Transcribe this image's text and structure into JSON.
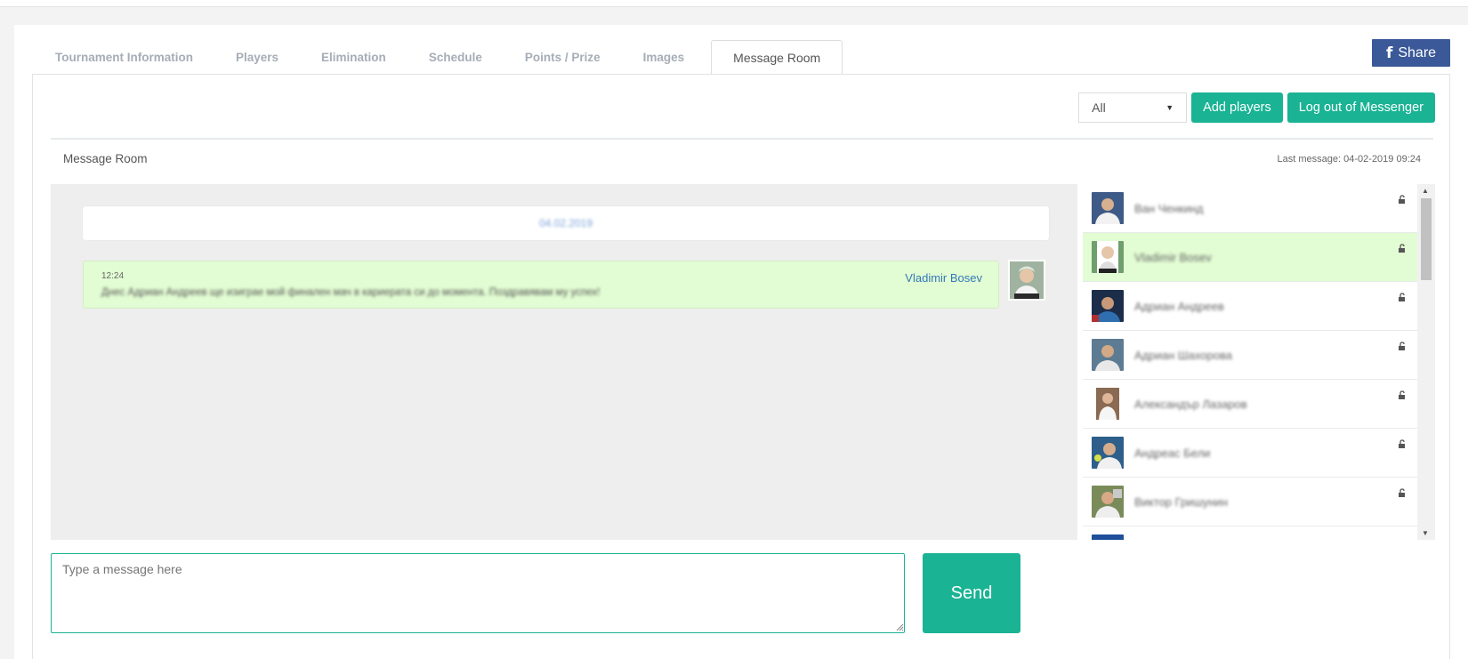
{
  "tabs": [
    {
      "label": "Tournament Information",
      "active": false
    },
    {
      "label": "Players",
      "active": false
    },
    {
      "label": "Elimination",
      "active": false
    },
    {
      "label": "Schedule",
      "active": false
    },
    {
      "label": "Points / Prize",
      "active": false
    },
    {
      "label": "Images",
      "active": false
    },
    {
      "label": "Message Room",
      "active": true
    }
  ],
  "share": {
    "label": "Share",
    "icon": "facebook-icon"
  },
  "toolbar": {
    "filter_value": "All",
    "add_players_label": "Add players",
    "logout_label": "Log out of Messenger"
  },
  "message_room": {
    "title": "Message Room",
    "last_message": "Last message: 04-02-2019 09:24"
  },
  "chat": {
    "date_separator": "04.02.2019",
    "messages": [
      {
        "time": "12:24",
        "author": "Vladimir Bosev",
        "text": "Днес Адриан Андреев ще изиграе мой финален мач в кариерата си до момента. Поздравявам му успех!"
      }
    ]
  },
  "players": [
    {
      "name": "Ван Ченкинд"
    },
    {
      "name": "Vladimir Bosev"
    },
    {
      "name": "Адриан Андреев"
    },
    {
      "name": "Адриан Шахорова"
    },
    {
      "name": "Александър Лазаров"
    },
    {
      "name": "Андреас Бели"
    },
    {
      "name": "Виктор Гришунин"
    }
  ],
  "composer": {
    "placeholder": "Type a message here",
    "send_label": "Send"
  },
  "colors": {
    "accent": "#1ab394",
    "facebook": "#3b5998",
    "message_bg": "#e2fcd3",
    "link": "#337ab7"
  }
}
